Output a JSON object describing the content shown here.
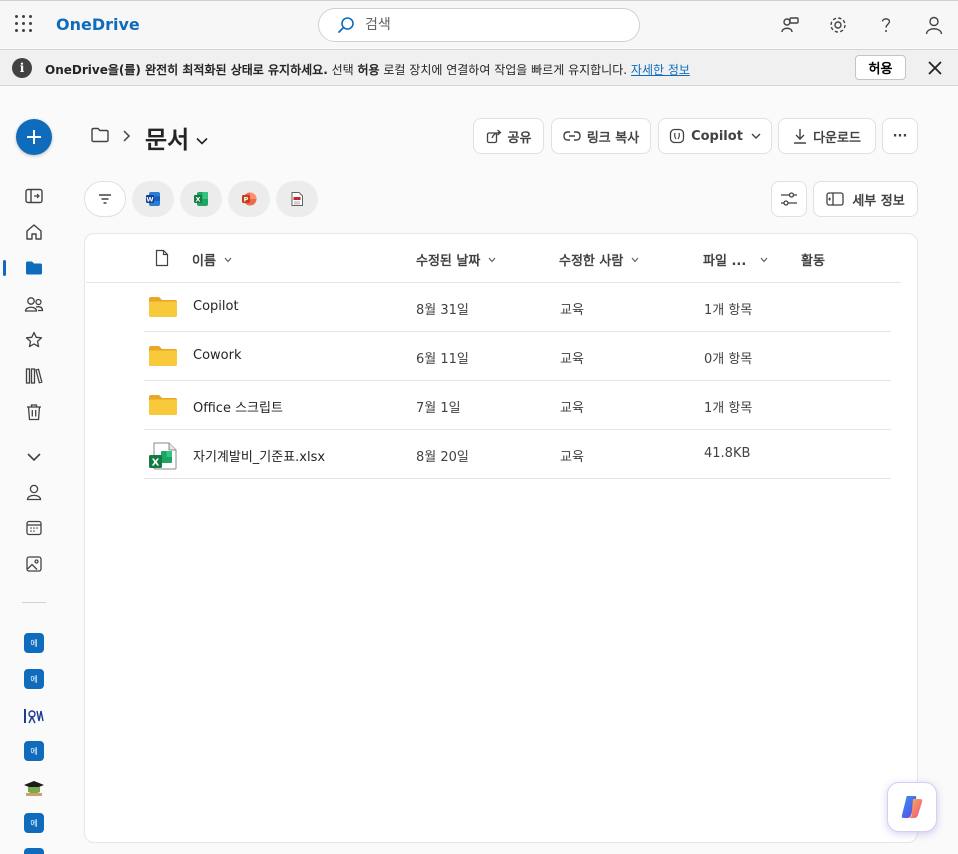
{
  "app": {
    "brand": "OneDrive"
  },
  "search": {
    "placeholder": "검색"
  },
  "notification": {
    "bold_text": "OneDrive을(를) 완전히 최적화된 상태로 유지하세요.",
    "text_a": " 선택 ",
    "allow_inline": "허용",
    "text_b": " 로컬 장치에 연결하여 작업을 빠르게 유지합니다. ",
    "link": "자세한 정보",
    "allow_button": "허용"
  },
  "header": {
    "title": "문서",
    "commands": {
      "share": "공유",
      "copy_link": "링크 복사",
      "copilot": "Copilot",
      "download": "다운로드",
      "more": "···",
      "details": "세부 정보"
    }
  },
  "columns": {
    "name": "이름",
    "modified": "수정된 날짜",
    "modified_by": "수정한 사람",
    "file_size": "파일 ...",
    "activity": "활동"
  },
  "files": [
    {
      "type": "folder",
      "name": "Copilot",
      "modified": "8월 31일",
      "modified_by": "교육",
      "size": "1개 항목"
    },
    {
      "type": "folder",
      "name": "Cowork",
      "modified": "6월 11일",
      "modified_by": "교육",
      "size": "0개 항목"
    },
    {
      "type": "folder",
      "name": "Office 스크립트",
      "modified": "7월 1일",
      "modified_by": "교육",
      "size": "1개 항목"
    },
    {
      "type": "excel",
      "name": "자기계발비_기준표.xlsx",
      "modified": "8월 20일",
      "modified_by": "교육",
      "size": "41.8KB"
    }
  ],
  "sites": {
    "s1": "에",
    "s2": "에",
    "s4": "에",
    "s6": "에"
  },
  "colors": {
    "accent": "#0f6cbd",
    "folder": "#f8c93b",
    "excel": "#107c41"
  }
}
